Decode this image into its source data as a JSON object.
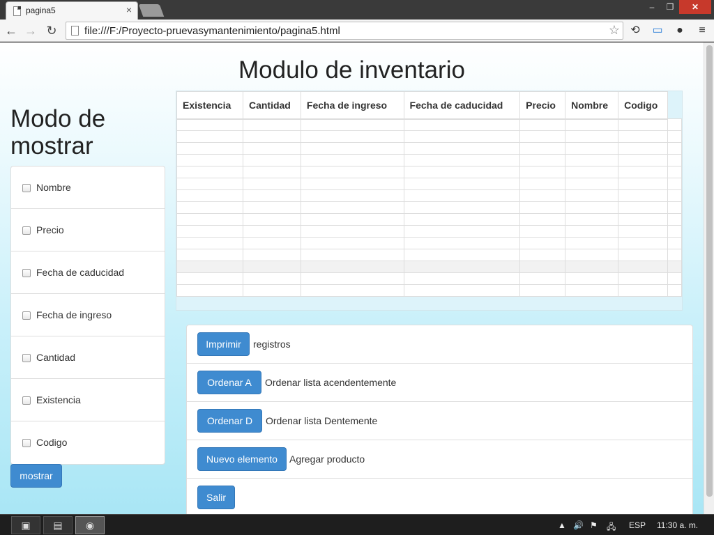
{
  "browser": {
    "tab_title": "pagina5",
    "tab_close": "×",
    "url": "file:///F:/Proyecto-pruevasymantenimiento/pagina5.html",
    "icons": {
      "back": "←",
      "forward": "→",
      "reload": "↻",
      "star": "☆",
      "ext1": "⟲",
      "ext2": "▭",
      "ext3": "●",
      "menu": "≡",
      "minimize": "–",
      "maximize": "❐",
      "close": "✕"
    }
  },
  "page": {
    "module_title": "Modulo de inventario",
    "side_title": "Modo de mostrar",
    "checkbox_items": [
      "Nombre",
      "Precio",
      "Fecha de caducidad",
      "Fecha de ingreso",
      "Cantidad",
      "Existencia",
      "Codigo"
    ],
    "show_button": "mostrar",
    "table": {
      "headers": [
        "Existencia",
        "Cantidad",
        "Fecha de ingreso",
        "Fecha de caducidad",
        "Precio",
        "Nombre",
        "Codigo"
      ]
    },
    "actions": [
      {
        "button": "Imprimir",
        "description": "registros"
      },
      {
        "button": "Ordenar A",
        "description": "Ordenar lista acendentemente"
      },
      {
        "button": "Ordenar D",
        "description": "Ordenar lista Dentemente"
      },
      {
        "button": "Nuevo elemento",
        "description": "Agregar producto"
      },
      {
        "button": "Salir",
        "description": ""
      }
    ]
  },
  "taskbar": {
    "tray_up": "▲",
    "tray_volume": "🔊",
    "tray_flag": "⚑",
    "tray_network": "🖧",
    "language": "ESP",
    "time": "11:30 a. m."
  },
  "colors": {
    "primary_button": "#3f8bd0",
    "close_button": "#c7392b",
    "page_gradient_end": "#a9e6f5"
  }
}
